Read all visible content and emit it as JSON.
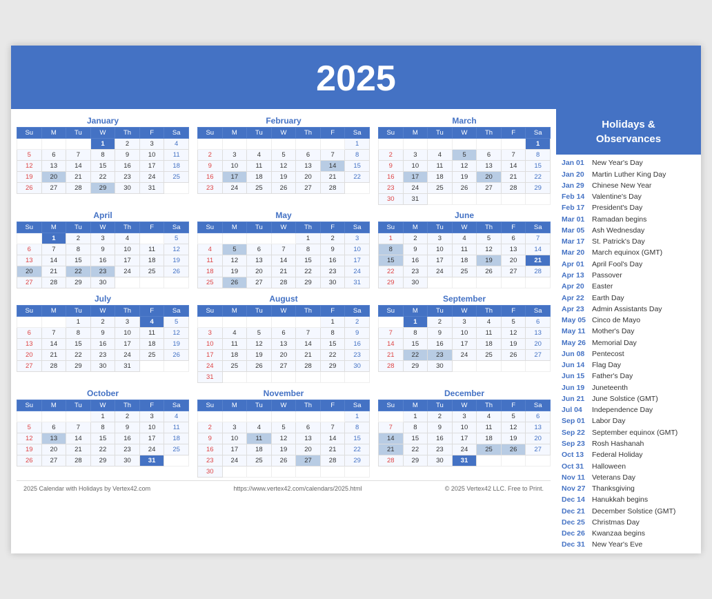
{
  "header": {
    "year": "2025"
  },
  "holidays_panel": {
    "title": "Holidays &\nObservances",
    "items": [
      {
        "date": "Jan 01",
        "name": "New Year's Day"
      },
      {
        "date": "Jan 20",
        "name": "Martin Luther King Day"
      },
      {
        "date": "Jan 29",
        "name": "Chinese New Year"
      },
      {
        "date": "Feb 14",
        "name": "Valentine's Day"
      },
      {
        "date": "Feb 17",
        "name": "President's Day"
      },
      {
        "date": "Mar 01",
        "name": "Ramadan begins"
      },
      {
        "date": "Mar 05",
        "name": "Ash Wednesday"
      },
      {
        "date": "Mar 17",
        "name": "St. Patrick's Day"
      },
      {
        "date": "Mar 20",
        "name": "March equinox (GMT)"
      },
      {
        "date": "Apr 01",
        "name": "April Fool's Day"
      },
      {
        "date": "Apr 13",
        "name": "Passover"
      },
      {
        "date": "Apr 20",
        "name": "Easter"
      },
      {
        "date": "Apr 22",
        "name": "Earth Day"
      },
      {
        "date": "Apr 23",
        "name": "Admin Assistants Day"
      },
      {
        "date": "May 05",
        "name": "Cinco de Mayo"
      },
      {
        "date": "May 11",
        "name": "Mother's Day"
      },
      {
        "date": "May 26",
        "name": "Memorial Day"
      },
      {
        "date": "Jun 08",
        "name": "Pentecost"
      },
      {
        "date": "Jun 14",
        "name": "Flag Day"
      },
      {
        "date": "Jun 15",
        "name": "Father's Day"
      },
      {
        "date": "Jun 19",
        "name": "Juneteenth"
      },
      {
        "date": "Jun 21",
        "name": "June Solstice (GMT)"
      },
      {
        "date": "Jul 04",
        "name": "Independence Day"
      },
      {
        "date": "Sep 01",
        "name": "Labor Day"
      },
      {
        "date": "Sep 22",
        "name": "September equinox (GMT)"
      },
      {
        "date": "Sep 23",
        "name": "Rosh Hashanah"
      },
      {
        "date": "Oct 13",
        "name": "Federal Holiday"
      },
      {
        "date": "Oct 31",
        "name": "Halloween"
      },
      {
        "date": "Nov 11",
        "name": "Veterans Day"
      },
      {
        "date": "Nov 27",
        "name": "Thanksgiving"
      },
      {
        "date": "Dec 14",
        "name": "Hanukkah begins"
      },
      {
        "date": "Dec 21",
        "name": "December Solstice (GMT)"
      },
      {
        "date": "Dec 25",
        "name": "Christmas Day"
      },
      {
        "date": "Dec 26",
        "name": "Kwanzaa begins"
      },
      {
        "date": "Dec 31",
        "name": "New Year's Eve"
      }
    ]
  },
  "footer": {
    "left": "2025 Calendar with Holidays by Vertex42.com",
    "center": "https://www.vertex42.com/calendars/2025.html",
    "right": "© 2025 Vertex42 LLC. Free to Print."
  }
}
